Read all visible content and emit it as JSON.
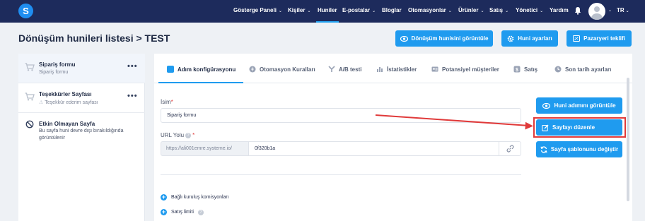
{
  "nav": {
    "logo_letter": "S",
    "items": [
      {
        "label": "Gösterge Paneli",
        "chevron": true
      },
      {
        "label": "Kişiler",
        "chevron": true
      },
      {
        "label": "Huniler",
        "chevron": false,
        "active": true
      },
      {
        "label": "E-postalar",
        "chevron": true
      },
      {
        "label": "Bloglar",
        "chevron": false
      },
      {
        "label": "Otomasyonlar",
        "chevron": true
      },
      {
        "label": "Ürünler",
        "chevron": true
      },
      {
        "label": "Satış",
        "chevron": true
      },
      {
        "label": "Yönetici",
        "chevron": true
      },
      {
        "label": "Yardım",
        "chevron": false
      }
    ],
    "language": "TR",
    "chevron_glyph": "⌄"
  },
  "header": {
    "title": "Dönüşüm hunileri listesi > TEST",
    "view_funnel_label": "Dönüşüm hunisini görüntüle",
    "funnel_settings_label": "Huni ayarları",
    "marketplace_label": "Pazaryeri teklifi"
  },
  "sidebar": {
    "items": [
      {
        "title": "Sipariş formu",
        "subtitle": "Sipariş formu",
        "menu": "•••"
      },
      {
        "title": "Teşekkürler Sayfası",
        "subtitle": "Teşekkür ederim sayfası",
        "warning": "⚠",
        "menu": "•••"
      },
      {
        "title": "Etkin Olmayan Sayfa",
        "description": "Bu sayfa huni devre dışı bırakıldığında görüntülenir"
      }
    ]
  },
  "tabs": [
    {
      "label": "Adım konfigürasyonu",
      "active": true
    },
    {
      "label": "Otomasyon Kuralları"
    },
    {
      "label": "A/B testi"
    },
    {
      "label": "İstatistikler"
    },
    {
      "label": "Potansiyel müşteriler"
    },
    {
      "label": "Satış"
    },
    {
      "label": "Son tarih ayarları"
    }
  ],
  "form": {
    "name_label": "İsim",
    "name_value": "Sipariş formu",
    "url_label": "URL Yolu",
    "url_prefix": "https://ali001emre.systeme.io/",
    "url_value": "0f320b1a",
    "required_mark": "*",
    "help_glyph": "?",
    "plus_glyph": "+",
    "affiliate_label": "Bağlı kuruluş komisyonları",
    "sales_limit_label": "Satış limiti"
  },
  "actions": {
    "view_step_label": "Huni adımını görüntüle",
    "edit_page_label": "Sayfayı düzenle",
    "change_template_label": "Sayfa şablonunu değiştir"
  },
  "colors": {
    "nav_bg": "#1d2b5c",
    "accent": "#1f9bef",
    "annotation_red": "#e03a3a"
  }
}
